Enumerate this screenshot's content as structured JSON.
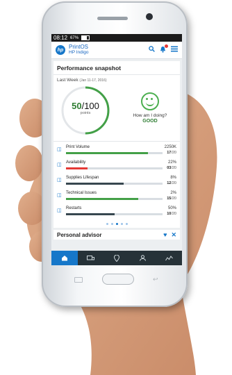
{
  "status_bar": {
    "time": "08:12",
    "battery": "67%"
  },
  "app": {
    "brand_line1": "PrintOS",
    "brand_line2": "HP Indigo",
    "logo_text": "hp"
  },
  "snapshot": {
    "title": "Performance snapshot",
    "period_label": "Last Week",
    "period_range": "(Jan 11-17, 2016)",
    "score": "50",
    "score_max": "/100",
    "score_unit": "points",
    "score_fraction": 0.5,
    "doing_question": "How am I doing?",
    "doing_answer": "GOOD",
    "metrics": [
      {
        "name": "Print Volume",
        "value": "2250K",
        "score": "17",
        "max": "/20",
        "fill": 0.85,
        "color": "#43a047",
        "icon": "print-icon"
      },
      {
        "name": "Availability",
        "value": "22%",
        "score": "03",
        "max": "/20",
        "fill": 0.22,
        "color": "#e53935",
        "icon": "availability-icon"
      },
      {
        "name": "Supplies Lifespan",
        "value": "8%",
        "score": "12",
        "max": "/20",
        "fill": 0.6,
        "color": "#37474f",
        "icon": "supplies-icon"
      },
      {
        "name": "Technical Issues",
        "value": "2%",
        "score": "15",
        "max": "/20",
        "fill": 0.75,
        "color": "#43a047",
        "icon": "technical-icon"
      },
      {
        "name": "Restarts",
        "value": "50%",
        "score": "10",
        "max": "/20",
        "fill": 0.5,
        "color": "#37474f",
        "icon": "restarts-icon"
      }
    ],
    "pagination_active": 2
  },
  "advisor": {
    "title": "Personal advisor"
  },
  "colors": {
    "accent": "#1677c9",
    "good": "#43a047",
    "bad": "#e53935",
    "nav_bg": "#263238"
  }
}
